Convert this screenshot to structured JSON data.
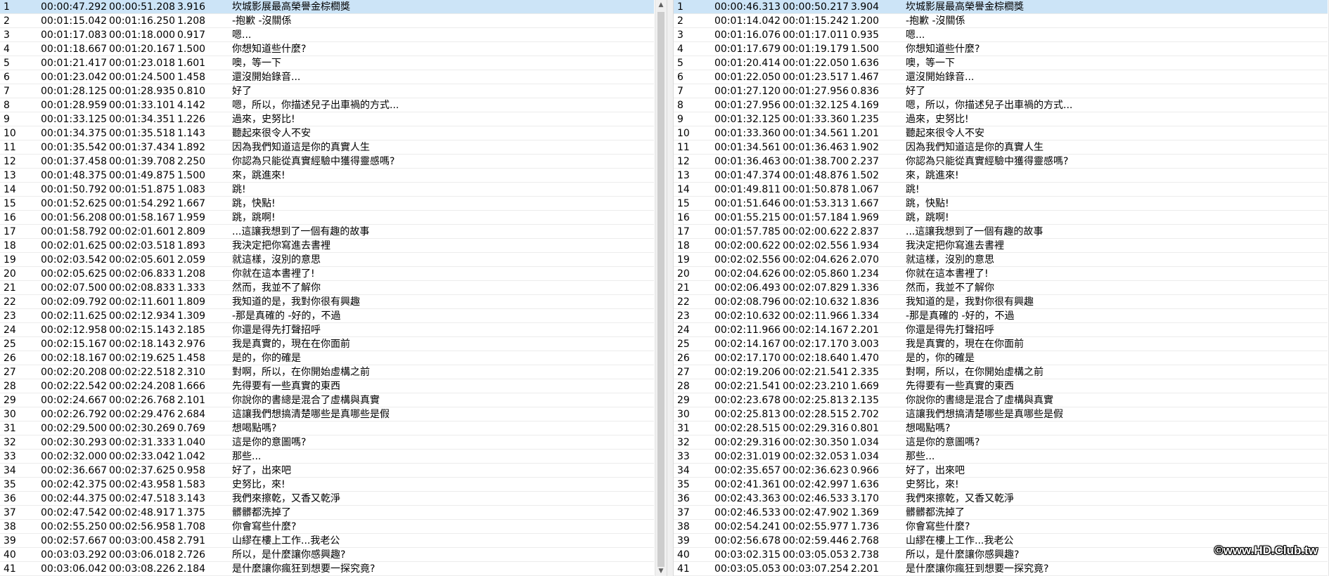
{
  "left_pane": {
    "selected_row": 0,
    "rows": [
      [
        "1",
        "00:00:47.292",
        "00:00:51.208",
        "3.916",
        "坎城影展最高榮譽金棕櫚獎"
      ],
      [
        "2",
        "00:01:15.042",
        "00:01:16.250",
        "1.208",
        "-抱歉 -沒關係"
      ],
      [
        "3",
        "00:01:17.083",
        "00:01:18.000",
        "0.917",
        "嗯..."
      ],
      [
        "4",
        "00:01:18.667",
        "00:01:20.167",
        "1.500",
        "你想知道些什麼?"
      ],
      [
        "5",
        "00:01:21.417",
        "00:01:23.018",
        "1.601",
        "噢，等一下"
      ],
      [
        "6",
        "00:01:23.042",
        "00:01:24.500",
        "1.458",
        "還沒開始錄音..."
      ],
      [
        "7",
        "00:01:28.125",
        "00:01:28.935",
        "0.810",
        "好了"
      ],
      [
        "8",
        "00:01:28.959",
        "00:01:33.101",
        "4.142",
        "嗯，所以，你描述兒子出車禍的方式..."
      ],
      [
        "9",
        "00:01:33.125",
        "00:01:34.351",
        "1.226",
        "過來，史努比!"
      ],
      [
        "10",
        "00:01:34.375",
        "00:01:35.518",
        "1.143",
        "聽起來很令人不安"
      ],
      [
        "11",
        "00:01:35.542",
        "00:01:37.434",
        "1.892",
        "因為我們知道這是你的真實人生"
      ],
      [
        "12",
        "00:01:37.458",
        "00:01:39.708",
        "2.250",
        "你認為只能從真實經驗中獲得靈感嗎?"
      ],
      [
        "13",
        "00:01:48.375",
        "00:01:49.875",
        "1.500",
        "來，跳進來!"
      ],
      [
        "14",
        "00:01:50.792",
        "00:01:51.875",
        "1.083",
        "跳!"
      ],
      [
        "15",
        "00:01:52.625",
        "00:01:54.292",
        "1.667",
        "跳，快點!"
      ],
      [
        "16",
        "00:01:56.208",
        "00:01:58.167",
        "1.959",
        "跳，跳啊!"
      ],
      [
        "17",
        "00:01:58.792",
        "00:02:01.601",
        "2.809",
        "...這讓我想到了一個有趣的故事"
      ],
      [
        "18",
        "00:02:01.625",
        "00:02:03.518",
        "1.893",
        "我決定把你寫進去書裡"
      ],
      [
        "19",
        "00:02:03.542",
        "00:02:05.601",
        "2.059",
        "就這樣，沒別的意思"
      ],
      [
        "20",
        "00:02:05.625",
        "00:02:06.833",
        "1.208",
        "你就在這本書裡了!"
      ],
      [
        "21",
        "00:02:07.500",
        "00:02:08.833",
        "1.333",
        "然而，我並不了解你"
      ],
      [
        "22",
        "00:02:09.792",
        "00:02:11.601",
        "1.809",
        "我知道的是，我對你很有興趣"
      ],
      [
        "23",
        "00:02:11.625",
        "00:02:12.934",
        "1.309",
        "-那是真確的 -好的，不過"
      ],
      [
        "24",
        "00:02:12.958",
        "00:02:15.143",
        "2.185",
        "你還是得先打聲招呼"
      ],
      [
        "25",
        "00:02:15.167",
        "00:02:18.143",
        "2.976",
        "我是真實的，現在在你面前"
      ],
      [
        "26",
        "00:02:18.167",
        "00:02:19.625",
        "1.458",
        "是的，你的確是"
      ],
      [
        "27",
        "00:02:20.208",
        "00:02:22.518",
        "2.310",
        "對啊，所以，在你開始虛構之前"
      ],
      [
        "28",
        "00:02:22.542",
        "00:02:24.208",
        "1.666",
        "先得要有一些真實的東西"
      ],
      [
        "29",
        "00:02:24.667",
        "00:02:26.768",
        "2.101",
        "你說你的書總是混合了虛構與真實"
      ],
      [
        "30",
        "00:02:26.792",
        "00:02:29.476",
        "2.684",
        "這讓我們想搞清楚哪些是真哪些是假"
      ],
      [
        "31",
        "00:02:29.500",
        "00:02:30.269",
        "0.769",
        "想喝點嗎?"
      ],
      [
        "32",
        "00:02:30.293",
        "00:02:31.333",
        "1.040",
        "這是你的意圖嗎?"
      ],
      [
        "33",
        "00:02:32.000",
        "00:02:33.042",
        "1.042",
        "那些..."
      ],
      [
        "34",
        "00:02:36.667",
        "00:02:37.625",
        "0.958",
        "好了，出來吧"
      ],
      [
        "35",
        "00:02:42.375",
        "00:02:43.958",
        "1.583",
        "史努比，來!"
      ],
      [
        "36",
        "00:02:44.375",
        "00:02:47.518",
        "3.143",
        "我們來擦乾，又香又乾淨"
      ],
      [
        "37",
        "00:02:47.542",
        "00:02:48.917",
        "1.375",
        "髒髒都洗掉了"
      ],
      [
        "38",
        "00:02:55.250",
        "00:02:56.958",
        "1.708",
        "你會寫些什麼?"
      ],
      [
        "39",
        "00:02:57.667",
        "00:03:00.458",
        "2.791",
        "山繆在樓上工作...我老公"
      ],
      [
        "40",
        "00:03:03.292",
        "00:03:06.018",
        "2.726",
        "所以，是什麼讓你感興趣?"
      ],
      [
        "41",
        "00:03:06.042",
        "00:03:08.226",
        "2.184",
        "是什麼讓你瘋狂到想要一探究竟?"
      ]
    ]
  },
  "right_pane": {
    "selected_row": 0,
    "rows": [
      [
        "1",
        "00:00:46.313",
        "00:00:50.217",
        "3.904",
        "坎城影展最高榮譽金棕櫚獎"
      ],
      [
        "2",
        "00:01:14.042",
        "00:01:15.242",
        "1.200",
        "-抱歉 -沒關係"
      ],
      [
        "3",
        "00:01:16.076",
        "00:01:17.011",
        "0.935",
        "嗯..."
      ],
      [
        "4",
        "00:01:17.679",
        "00:01:19.179",
        "1.500",
        "你想知道些什麼?"
      ],
      [
        "5",
        "00:01:20.414",
        "00:01:22.050",
        "1.636",
        "噢，等一下"
      ],
      [
        "6",
        "00:01:22.050",
        "00:01:23.517",
        "1.467",
        "還沒開始錄音..."
      ],
      [
        "7",
        "00:01:27.120",
        "00:01:27.956",
        "0.836",
        "好了"
      ],
      [
        "8",
        "00:01:27.956",
        "00:01:32.125",
        "4.169",
        "嗯，所以，你描述兒子出車禍的方式..."
      ],
      [
        "9",
        "00:01:32.125",
        "00:01:33.360",
        "1.235",
        "過來，史努比!"
      ],
      [
        "10",
        "00:01:33.360",
        "00:01:34.561",
        "1.201",
        "聽起來很令人不安"
      ],
      [
        "11",
        "00:01:34.561",
        "00:01:36.463",
        "1.902",
        "因為我們知道這是你的真實人生"
      ],
      [
        "12",
        "00:01:36.463",
        "00:01:38.700",
        "2.237",
        "你認為只能從真實經驗中獲得靈感嗎?"
      ],
      [
        "13",
        "00:01:47.374",
        "00:01:48.876",
        "1.502",
        "來，跳進來!"
      ],
      [
        "14",
        "00:01:49.811",
        "00:01:50.878",
        "1.067",
        "跳!"
      ],
      [
        "15",
        "00:01:51.646",
        "00:01:53.313",
        "1.667",
        "跳，快點!"
      ],
      [
        "16",
        "00:01:55.215",
        "00:01:57.184",
        "1.969",
        "跳，跳啊!"
      ],
      [
        "17",
        "00:01:57.785",
        "00:02:00.622",
        "2.837",
        "...這讓我想到了一個有趣的故事"
      ],
      [
        "18",
        "00:02:00.622",
        "00:02:02.556",
        "1.934",
        "我決定把你寫進去書裡"
      ],
      [
        "19",
        "00:02:02.556",
        "00:02:04.626",
        "2.070",
        "就這樣，沒別的意思"
      ],
      [
        "20",
        "00:02:04.626",
        "00:02:05.860",
        "1.234",
        "你就在這本書裡了!"
      ],
      [
        "21",
        "00:02:06.493",
        "00:02:07.829",
        "1.336",
        "然而，我並不了解你"
      ],
      [
        "22",
        "00:02:08.796",
        "00:02:10.632",
        "1.836",
        "我知道的是，我對你很有興趣"
      ],
      [
        "23",
        "00:02:10.632",
        "00:02:11.966",
        "1.334",
        "-那是真確的 -好的，不過"
      ],
      [
        "24",
        "00:02:11.966",
        "00:02:14.167",
        "2.201",
        "你還是得先打聲招呼"
      ],
      [
        "25",
        "00:02:14.167",
        "00:02:17.170",
        "3.003",
        "我是真實的，現在在你面前"
      ],
      [
        "26",
        "00:02:17.170",
        "00:02:18.640",
        "1.470",
        "是的，你的確是"
      ],
      [
        "27",
        "00:02:19.206",
        "00:02:21.541",
        "2.335",
        "對啊，所以，在你開始虛構之前"
      ],
      [
        "28",
        "00:02:21.541",
        "00:02:23.210",
        "1.669",
        "先得要有一些真實的東西"
      ],
      [
        "29",
        "00:02:23.678",
        "00:02:25.813",
        "2.135",
        "你說你的書總是混合了虛構與真實"
      ],
      [
        "30",
        "00:02:25.813",
        "00:02:28.515",
        "2.702",
        "這讓我們想搞清楚哪些是真哪些是假"
      ],
      [
        "31",
        "00:02:28.515",
        "00:02:29.316",
        "0.801",
        "想喝點嗎?"
      ],
      [
        "32",
        "00:02:29.316",
        "00:02:30.350",
        "1.034",
        "這是你的意圖嗎?"
      ],
      [
        "33",
        "00:02:31.019",
        "00:02:32.053",
        "1.034",
        "那些..."
      ],
      [
        "34",
        "00:02:35.657",
        "00:02:36.623",
        "0.966",
        "好了，出來吧"
      ],
      [
        "35",
        "00:02:41.361",
        "00:02:42.997",
        "1.636",
        "史努比，來!"
      ],
      [
        "36",
        "00:02:43.363",
        "00:02:46.533",
        "3.170",
        "我們來擦乾，又香又乾淨"
      ],
      [
        "37",
        "00:02:46.533",
        "00:02:47.902",
        "1.369",
        "髒髒都洗掉了"
      ],
      [
        "38",
        "00:02:54.241",
        "00:02:55.977",
        "1.736",
        "你會寫些什麼?"
      ],
      [
        "39",
        "00:02:56.678",
        "00:02:59.446",
        "2.768",
        "山繆在樓上工作...我老公"
      ],
      [
        "40",
        "00:03:02.315",
        "00:03:05.053",
        "2.738",
        "所以，是什麼讓你感興趣?"
      ],
      [
        "41",
        "00:03:05.053",
        "00:03:07.254",
        "2.201",
        "是什麼讓你瘋狂到想要一探究竟?"
      ]
    ]
  },
  "watermark": "©www.HD.Club.tw",
  "colors": {
    "selection": "#cce4f7",
    "background": "#ffffff",
    "scrollbar": "#cdcdcd"
  }
}
